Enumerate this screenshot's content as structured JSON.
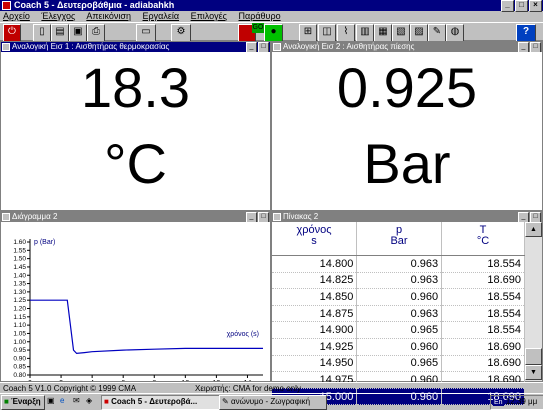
{
  "window": {
    "title": "Coach 5 - Δευτεροβάθμια - adiabahkh"
  },
  "menu": [
    "Αρχείο",
    "Έλεγχος",
    "Απεικόνιση",
    "Εργαλεία",
    "Επιλογές",
    "Παράθυρο"
  ],
  "panels": {
    "analog1": {
      "title": "Αναλογική Εισ 1 : Αισθητήρας θερμοκρασίας",
      "value": "18.3",
      "unit": "°C"
    },
    "analog2": {
      "title": "Αναλογική Εισ 2 : Αισθητήρας πίεσης",
      "value": "0.925",
      "unit": "Bar"
    },
    "graph": {
      "title": "Διάγραμμα 2"
    },
    "table": {
      "title": "Πίνακας 2"
    }
  },
  "table": {
    "headers": [
      {
        "name": "χρόνος",
        "unit": "s"
      },
      {
        "name": "p",
        "unit": "Bar"
      },
      {
        "name": "T",
        "unit": "°C"
      }
    ],
    "rows": [
      [
        "14.800",
        "0.963",
        "18.554"
      ],
      [
        "14.825",
        "0.963",
        "18.690"
      ],
      [
        "14.850",
        "0.960",
        "18.554"
      ],
      [
        "14.875",
        "0.963",
        "18.554"
      ],
      [
        "14.900",
        "0.965",
        "18.554"
      ],
      [
        "14.925",
        "0.960",
        "18.690"
      ],
      [
        "14.950",
        "0.965",
        "18.690"
      ],
      [
        "14.975",
        "0.960",
        "18.690"
      ],
      [
        "15.000",
        "0.960",
        "18.690"
      ]
    ],
    "selected_row": 8
  },
  "chart_data": {
    "type": "line",
    "ylabel": "p (Bar)",
    "xlabel": "χρόνος (s)",
    "xlim": [
      0,
      15
    ],
    "ylim": [
      0.8,
      1.6
    ],
    "x_ticks": [
      "0",
      "2",
      "4",
      "6",
      "8",
      "10",
      "12",
      "14"
    ],
    "y_ticks": [
      "1.60",
      "1.55",
      "1.50",
      "1.45",
      "1.40",
      "1.35",
      "1.30",
      "1.25",
      "1.20",
      "1.15",
      "1.10",
      "1.05",
      "1.00",
      "0.95",
      "0.90",
      "0.85",
      "0.80"
    ],
    "series": [
      {
        "color": "#0000c0",
        "x": [
          0,
          1,
          2,
          2.4,
          2.6,
          2.8,
          3.0,
          3.5,
          4,
          6,
          8,
          10,
          12,
          14,
          15
        ],
        "y": [
          1.25,
          1.25,
          1.25,
          1.25,
          1.1,
          0.95,
          0.93,
          0.935,
          0.94,
          0.95,
          0.955,
          0.96,
          0.96,
          0.96,
          0.96
        ]
      }
    ]
  },
  "statusbar": {
    "left": "Coach 5 V1.0 Copyright © 1999 CMA",
    "right": "Χειριστής: CMA for demo only"
  },
  "taskbar": {
    "start": "Έναρξη",
    "tasks": [
      "Coach 5 - Δευτεροβά...",
      "ανώνυμο - Ζωγραφική"
    ],
    "lang": "En",
    "clock": "12:39 μμ"
  },
  "colors": {
    "titlebar": "#000080",
    "selection": "#000080",
    "plot_line": "#0000c0"
  }
}
